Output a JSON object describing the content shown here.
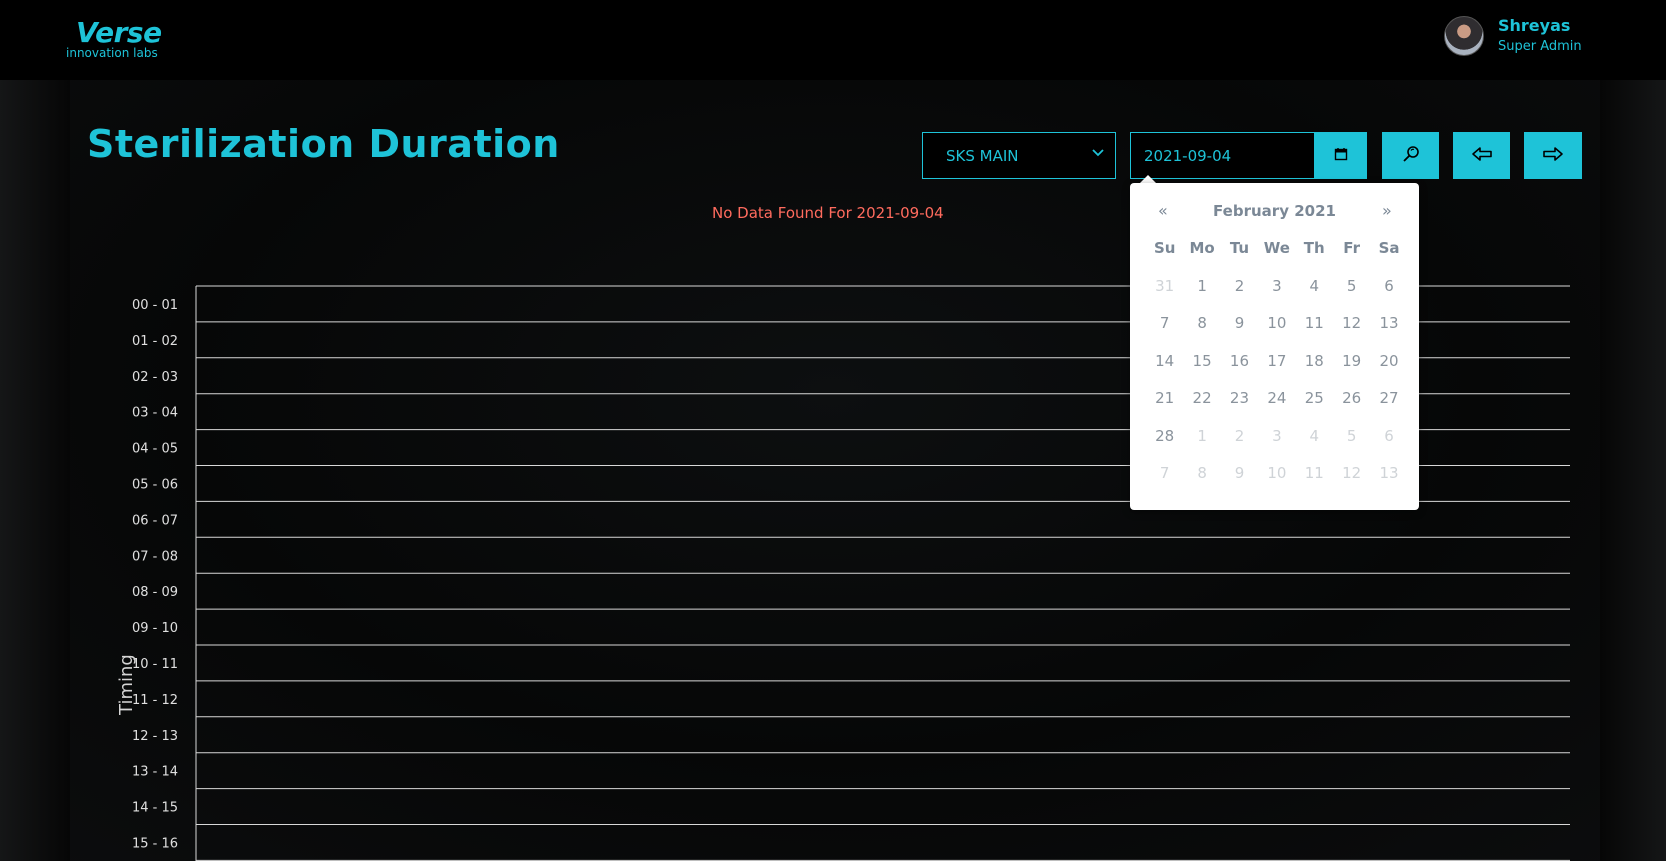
{
  "header": {
    "logo_word": "Verse",
    "logo_sub": "innovation labs",
    "user_name": "Shreyas",
    "user_role": "Super Admin"
  },
  "page": {
    "title": "Sterilization Duration",
    "location_select": "SKS MAIN",
    "date_value": "2021-09-04",
    "no_data_message": "No Data Found For 2021-09-04"
  },
  "icons": {
    "calendar": "calendar-icon",
    "search": "search-icon",
    "prev": "arrow-left-icon",
    "next": "arrow-right-icon"
  },
  "colors": {
    "accent": "#1ec3d8",
    "error": "#ff6b5e",
    "background": "#000000"
  },
  "datepicker": {
    "prev_label": "«",
    "next_label": "»",
    "month_label": "February 2021",
    "weekdays": [
      "Su",
      "Mo",
      "Tu",
      "We",
      "Th",
      "Fr",
      "Sa"
    ],
    "weeks": [
      [
        {
          "d": "31",
          "o": true
        },
        {
          "d": "1"
        },
        {
          "d": "2"
        },
        {
          "d": "3"
        },
        {
          "d": "4"
        },
        {
          "d": "5"
        },
        {
          "d": "6"
        }
      ],
      [
        {
          "d": "7"
        },
        {
          "d": "8"
        },
        {
          "d": "9"
        },
        {
          "d": "10"
        },
        {
          "d": "11"
        },
        {
          "d": "12"
        },
        {
          "d": "13"
        }
      ],
      [
        {
          "d": "14"
        },
        {
          "d": "15"
        },
        {
          "d": "16"
        },
        {
          "d": "17"
        },
        {
          "d": "18"
        },
        {
          "d": "19"
        },
        {
          "d": "20"
        }
      ],
      [
        {
          "d": "21"
        },
        {
          "d": "22"
        },
        {
          "d": "23"
        },
        {
          "d": "24"
        },
        {
          "d": "25"
        },
        {
          "d": "26"
        },
        {
          "d": "27"
        }
      ],
      [
        {
          "d": "28"
        },
        {
          "d": "1",
          "o": true
        },
        {
          "d": "2",
          "o": true
        },
        {
          "d": "3",
          "o": true
        },
        {
          "d": "4",
          "o": true
        },
        {
          "d": "5",
          "o": true
        },
        {
          "d": "6",
          "o": true
        }
      ],
      [
        {
          "d": "7",
          "o": true
        },
        {
          "d": "8",
          "o": true
        },
        {
          "d": "9",
          "o": true
        },
        {
          "d": "10",
          "o": true
        },
        {
          "d": "11",
          "o": true
        },
        {
          "d": "12",
          "o": true
        },
        {
          "d": "13",
          "o": true
        }
      ]
    ]
  },
  "chart_data": {
    "type": "bar",
    "title": "",
    "ylabel": "Timing",
    "xlabel": "",
    "categories": [
      "00 - 01",
      "01 - 02",
      "02 - 03",
      "03 - 04",
      "04 - 05",
      "05 - 06",
      "06 - 07",
      "07 - 08",
      "08 - 09",
      "09 - 10",
      "10 - 11",
      "11 - 12",
      "12 - 13",
      "13 - 14",
      "14 - 15",
      "15 - 16"
    ],
    "series": [],
    "grid": true
  }
}
